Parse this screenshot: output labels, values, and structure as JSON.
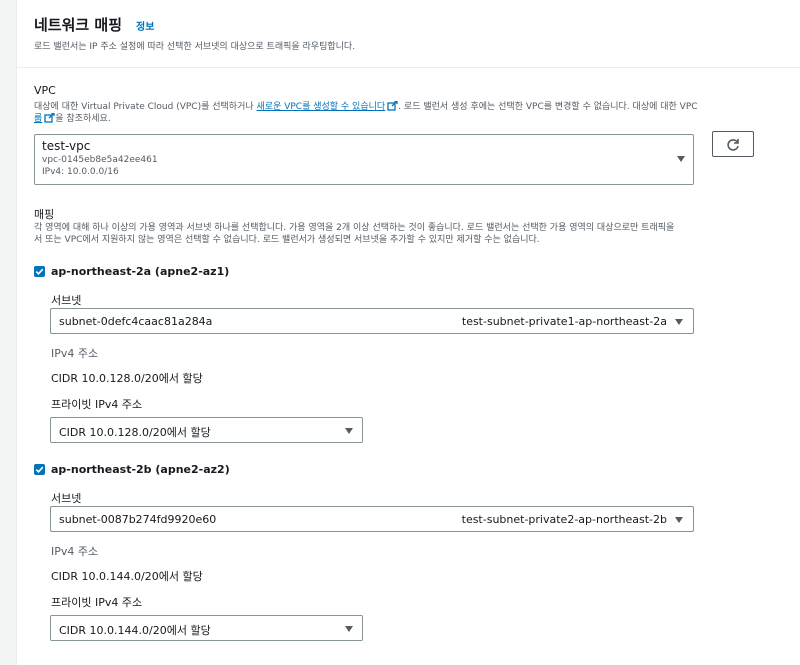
{
  "header": {
    "title": "네트워크 매핑",
    "info_link": "정보",
    "description": "로드 밸런서는 IP 주소 설정에 따라 선택한 서브넷의 대상으로 트래픽을 라우팅합니다."
  },
  "vpc": {
    "label": "VPC",
    "desc_part1": "대상에 대한 Virtual Private Cloud (VPC)를 선택하거나 ",
    "desc_link": "새로운 VPC를 생성할 수 있습니다",
    "desc_part2": ". 로드 밸런서 생성 후에는 선택한 VPC를 변경할 수 없습니다. 대상에 대한 VPC",
    "desc_line2_link": "룹",
    "desc_line2_rest": "을 참조하세요.",
    "selected_name": "test-vpc",
    "selected_id": "vpc-0145eb8e5a42ee461",
    "selected_cidr": "IPv4: 10.0.0.0/16",
    "refresh_icon": "refresh-icon"
  },
  "mapping": {
    "label": "매핑",
    "desc_line1": "각 영역에 대해 하나 이상의 가용 영역과 서브넷 하나를 선택합니다. 가용 영역을 2개 이상 선택하는 것이 좋습니다. 로드 밸런서는 선택한 가용 영역의 대상으로만 트래픽을",
    "desc_line2": "서 또는 VPC에서 지원하지 않는 영역은 선택할 수 없습니다. 로드 밸런서가 생성되면 서브넷을 추가할 수 있지만 제거할 수는 없습니다.",
    "zones": [
      {
        "az_label": "ap-northeast-2a (apne2-az1)",
        "checked": true,
        "subnet_label": "서브넷",
        "subnet_id": "subnet-0defc4caac81a284a",
        "subnet_name": "test-subnet-private1-ap-northeast-2a",
        "ipv4_label": "IPv4 주소",
        "ipv4_value": "CIDR 10.0.128.0/20에서 할당",
        "private_ipv4_label": "프라이빗 IPv4 주소",
        "private_ipv4_value": "CIDR 10.0.128.0/20에서 할당"
      },
      {
        "az_label": "ap-northeast-2b (apne2-az2)",
        "checked": true,
        "subnet_label": "서브넷",
        "subnet_id": "subnet-0087b274fd9920e60",
        "subnet_name": "test-subnet-private2-ap-northeast-2b",
        "ipv4_label": "IPv4 주소",
        "ipv4_value": "CIDR 10.0.144.0/20에서 할당",
        "private_ipv4_label": "프라이빗 IPv4 주소",
        "private_ipv4_value": "CIDR 10.0.144.0/20에서 할당"
      }
    ]
  },
  "colors": {
    "link": "#0073bb",
    "checkbox": "#0073bb",
    "border": "#879596",
    "page_bg": "#f2f3f3"
  }
}
